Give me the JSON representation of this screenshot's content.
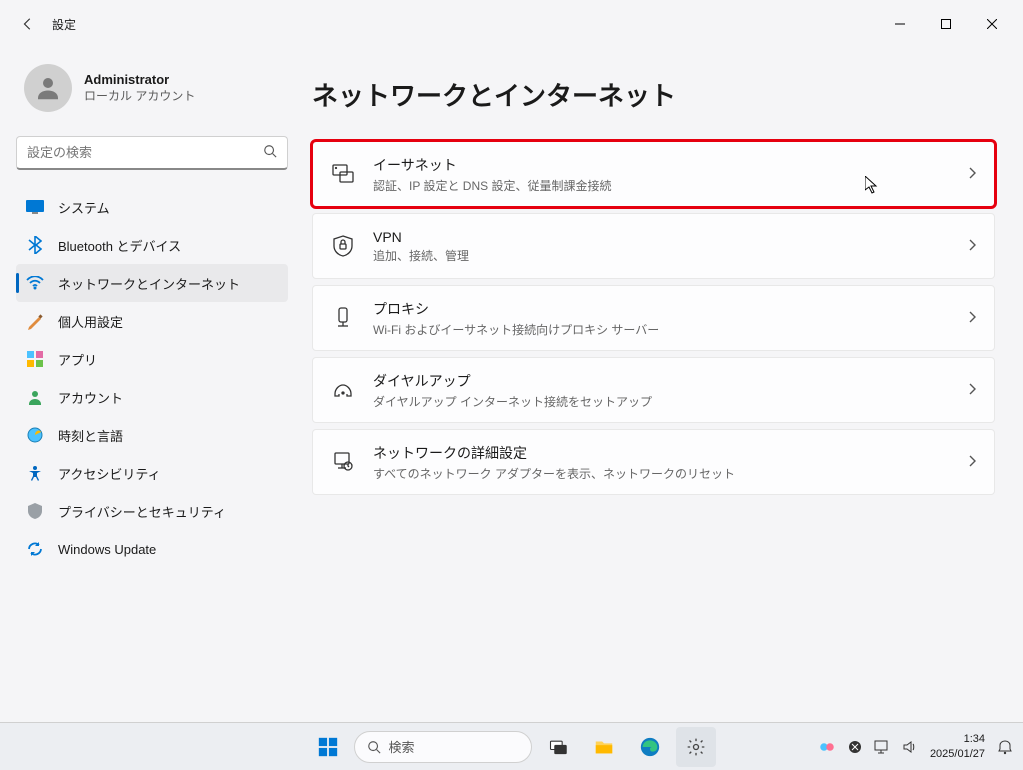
{
  "titlebar": {
    "title": "設定"
  },
  "profile": {
    "name": "Administrator",
    "sub": "ローカル アカウント"
  },
  "search": {
    "placeholder": "設定の検索"
  },
  "nav": [
    {
      "label": "システム",
      "icon": "system"
    },
    {
      "label": "Bluetooth とデバイス",
      "icon": "bluetooth"
    },
    {
      "label": "ネットワークとインターネット",
      "icon": "network",
      "active": true
    },
    {
      "label": "個人用設定",
      "icon": "personalize"
    },
    {
      "label": "アプリ",
      "icon": "apps"
    },
    {
      "label": "アカウント",
      "icon": "account"
    },
    {
      "label": "時刻と言語",
      "icon": "time"
    },
    {
      "label": "アクセシビリティ",
      "icon": "accessibility"
    },
    {
      "label": "プライバシーとセキュリティ",
      "icon": "privacy"
    },
    {
      "label": "Windows Update",
      "icon": "update"
    }
  ],
  "page": {
    "title": "ネットワークとインターネット"
  },
  "cards": [
    {
      "title": "イーサネット",
      "sub": "認証、IP 設定と DNS 設定、従量制課金接続",
      "icon": "ethernet",
      "highlight": true
    },
    {
      "title": "VPN",
      "sub": "追加、接続、管理",
      "icon": "vpn"
    },
    {
      "title": "プロキシ",
      "sub": "Wi-Fi およびイーサネット接続向けプロキシ サーバー",
      "icon": "proxy"
    },
    {
      "title": "ダイヤルアップ",
      "sub": "ダイヤルアップ インターネット接続をセットアップ",
      "icon": "dialup"
    },
    {
      "title": "ネットワークの詳細設定",
      "sub": "すべてのネットワーク アダプターを表示、ネットワークのリセット",
      "icon": "advanced"
    }
  ],
  "taskbar": {
    "search_placeholder": "検索",
    "time": "1:34",
    "date": "2025/01/27"
  }
}
